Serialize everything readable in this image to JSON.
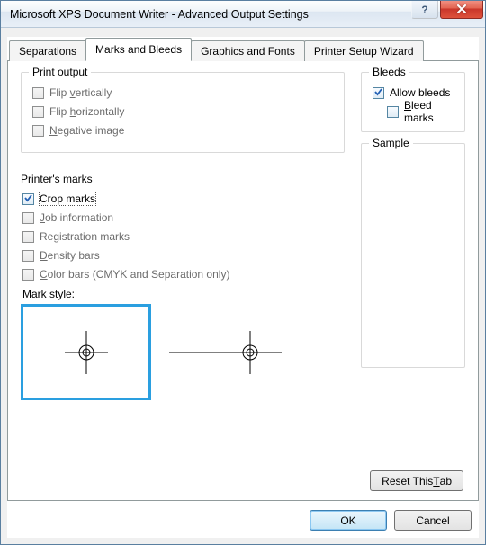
{
  "window": {
    "title": "Microsoft XPS Document Writer - Advanced Output Settings"
  },
  "tabs": {
    "separations": "Separations",
    "marks_bleeds": "Marks and Bleeds",
    "graphics_fonts": "Graphics and Fonts",
    "printer_setup": "Printer Setup Wizard"
  },
  "print_output": {
    "legend": "Print output",
    "flip_v": "Flip vertically",
    "flip_h": "Flip horizontally",
    "negative": "Negative image"
  },
  "printers_marks": {
    "legend": "Printer's marks",
    "crop": "Crop marks",
    "job_info": "Job information",
    "registration": "Registration marks",
    "density": "Density bars",
    "color_bars": "Color bars (CMYK and Separation only)",
    "mark_style_label": "Mark style:"
  },
  "bleeds": {
    "legend": "Bleeds",
    "allow": "Allow bleeds",
    "marks": "Bleed marks"
  },
  "sample": {
    "legend": "Sample"
  },
  "buttons": {
    "reset": "Reset This Tab",
    "ok": "OK",
    "cancel": "Cancel"
  }
}
